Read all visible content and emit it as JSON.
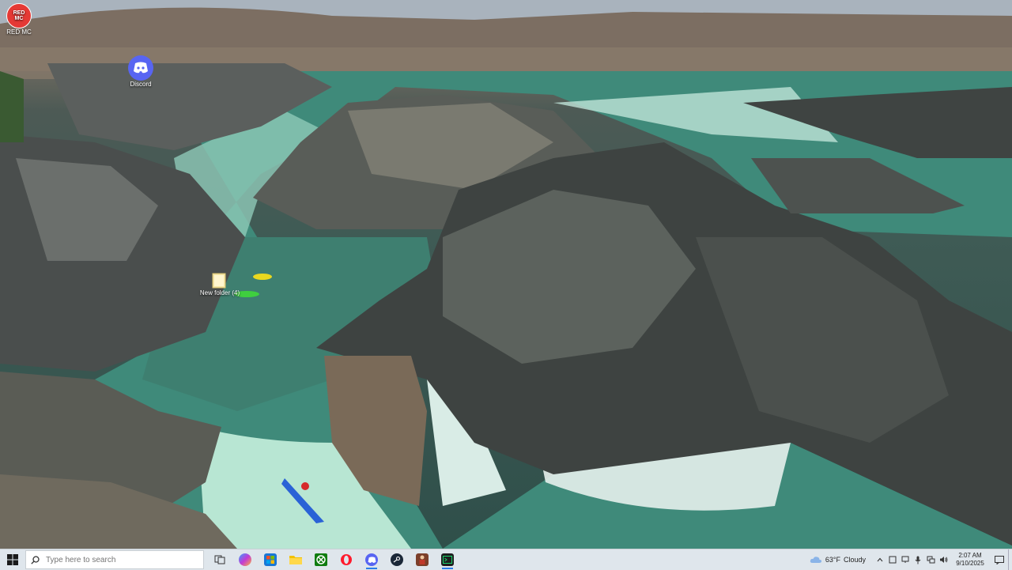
{
  "desktop": {
    "icons": [
      {
        "name": "RED MC",
        "glyph": "RED\nMC"
      },
      {
        "name": "Discord"
      },
      {
        "name": "New folder (4)"
      }
    ]
  },
  "taskbar": {
    "search": {
      "placeholder": "Type here to search"
    },
    "apps": [
      {
        "id": "task-view",
        "icon": "task-view-icon"
      },
      {
        "id": "copilot",
        "icon": "copilot-icon"
      },
      {
        "id": "microsoft-store",
        "icon": "store-icon"
      },
      {
        "id": "file-explorer",
        "icon": "folder-icon"
      },
      {
        "id": "xbox",
        "icon": "xbox-icon"
      },
      {
        "id": "opera",
        "icon": "opera-icon"
      },
      {
        "id": "discord",
        "icon": "discord-icon"
      },
      {
        "id": "steam",
        "icon": "steam-icon"
      },
      {
        "id": "game",
        "icon": "game-icon"
      },
      {
        "id": "terminal",
        "icon": "terminal-icon"
      }
    ],
    "weather": {
      "temp": "63°F",
      "condition": "Cloudy"
    },
    "clock": {
      "time": "2:07 AM",
      "date": "9/10/2025"
    },
    "colors": {
      "accent": "#2b7de9",
      "taskbar_bg": "#dfe6ec"
    }
  }
}
